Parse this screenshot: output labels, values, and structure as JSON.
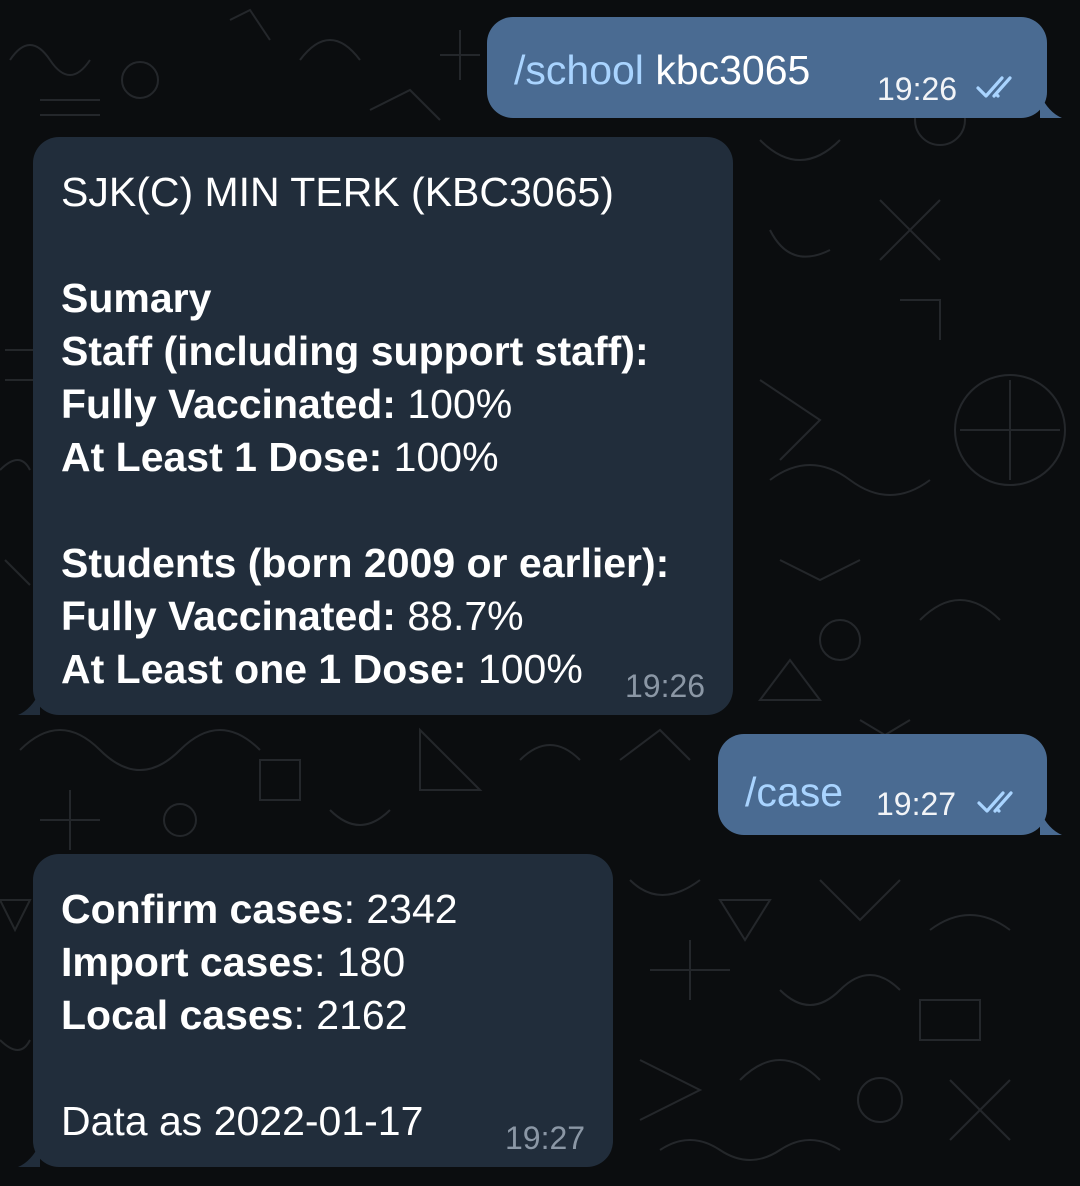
{
  "messages": [
    {
      "direction": "outgoing",
      "command": "/school",
      "argument": " kbc3065",
      "time": "19:26",
      "status_icon": "double-check-icon"
    },
    {
      "direction": "incoming",
      "time": "19:26",
      "lines": [
        {
          "value": "SJK(C) MIN TERK (KBC3065)"
        },
        {
          "label": "Sumary"
        },
        {
          "label": "Staff (including support staff):"
        },
        {
          "label": "Fully Vaccinated:",
          "value": " 100%"
        },
        {
          "label": "At Least 1 Dose:",
          "value": " 100%"
        },
        {
          "label": "Students (born 2009 or earlier):"
        },
        {
          "label": "Fully Vaccinated:",
          "value": " 88.7%"
        },
        {
          "label": "At Least one 1 Dose:",
          "value": " 100%"
        }
      ]
    },
    {
      "direction": "outgoing",
      "command": "/case",
      "time": "19:27",
      "status_icon": "double-check-icon"
    },
    {
      "direction": "incoming",
      "time": "19:27",
      "lines": [
        {
          "label": "Confirm cases",
          "value": ": 2342"
        },
        {
          "label": "Import cases",
          "value": ": 180"
        },
        {
          "label": "Local cases",
          "value": ": 2162"
        },
        {
          "value": "Data as 2022-01-17"
        }
      ]
    }
  ],
  "colors": {
    "background": "#0b0d0f",
    "outgoing_bubble": "#4a6b92",
    "incoming_bubble": "#212d3b",
    "command_link": "#a9d4ff",
    "incoming_time": "#8b97a5"
  }
}
